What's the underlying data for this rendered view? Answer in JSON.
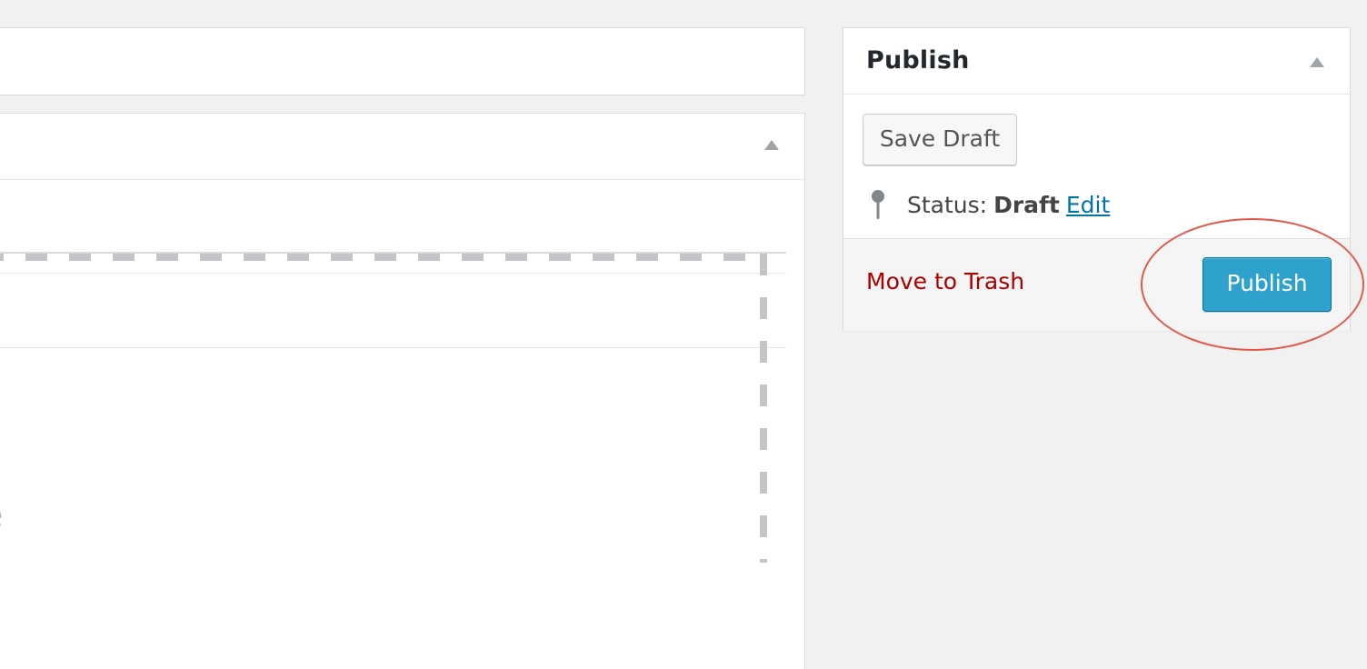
{
  "left_panel": {
    "title_input_value": "",
    "dropzone_partial_text": "e"
  },
  "publish": {
    "title": "Publish",
    "toggle_icon": "triangle-up-icon",
    "save_draft_label": "Save Draft",
    "status_label": "Status:",
    "status_value": "Draft",
    "status_edit_label": "Edit",
    "status_icon": "pin-icon",
    "move_to_trash_label": "Move to Trash",
    "publish_button_label": "Publish"
  },
  "colors": {
    "publish_button": "#2ea2cc",
    "trash_link": "#aa0000",
    "edit_link": "#0073aa",
    "highlight_ring": "#e2584a"
  }
}
